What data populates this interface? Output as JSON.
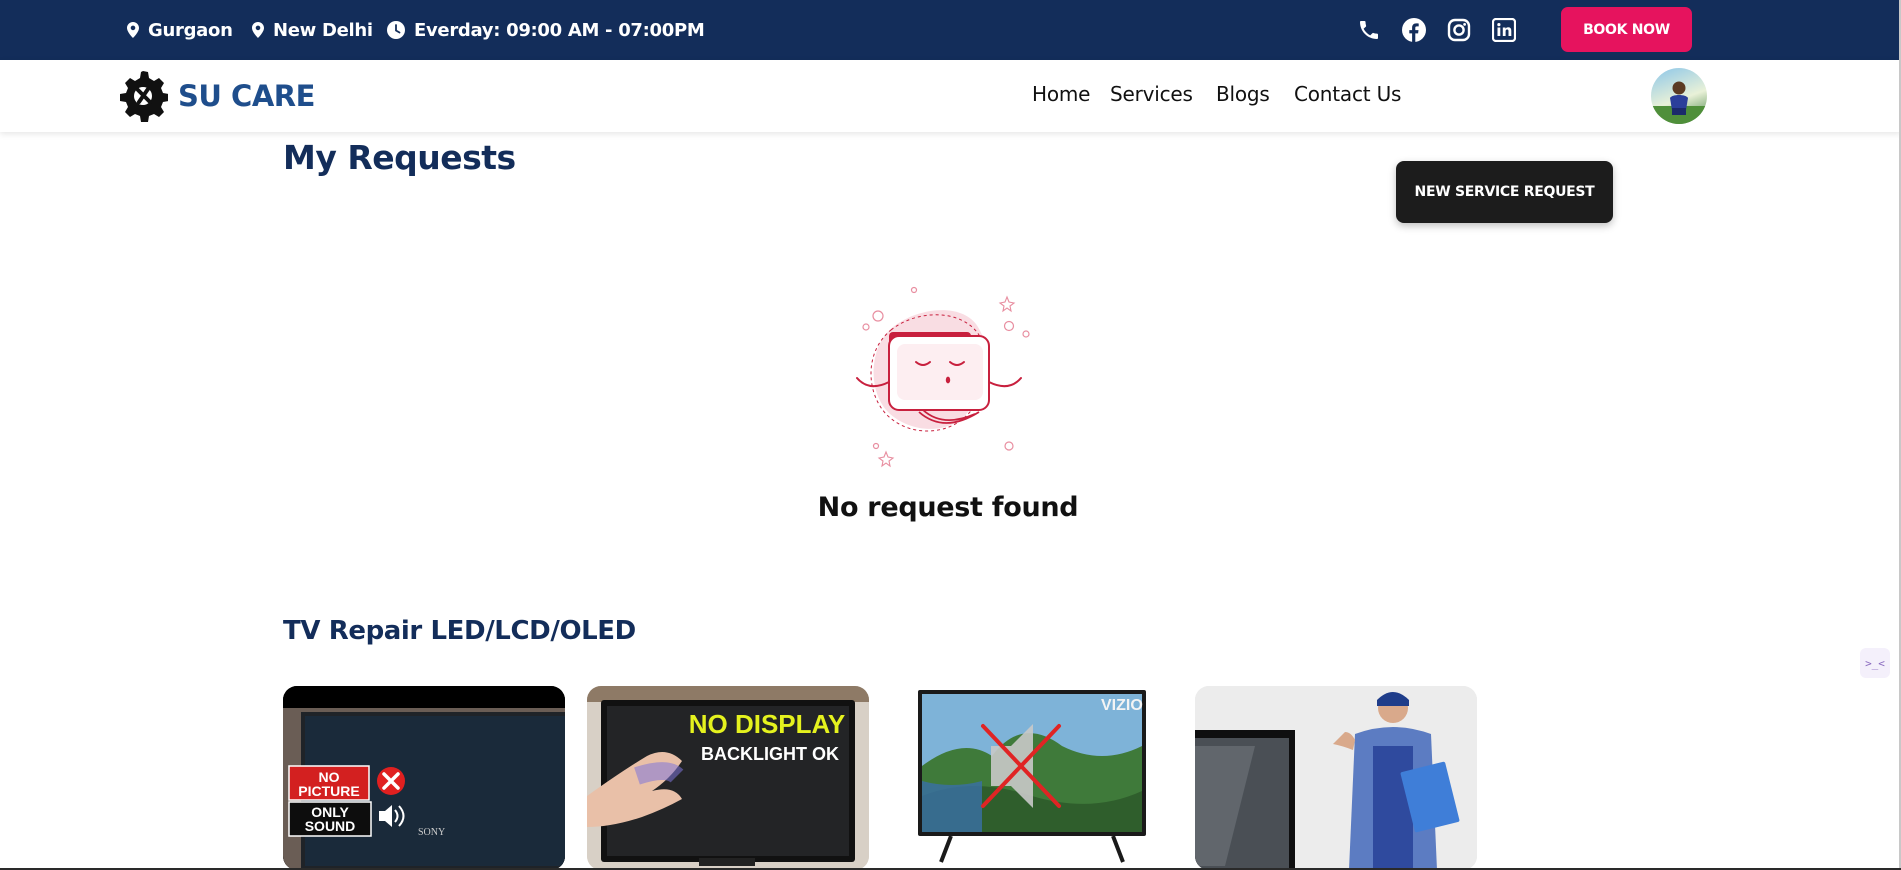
{
  "topbar": {
    "location_1": "Gurgaon",
    "location_2": "New Delhi",
    "hours": "Everday: 09:00 AM - 07:00PM",
    "book_label": "BOOK NOW"
  },
  "brand": {
    "name": "SU CARE"
  },
  "nav": {
    "home": "Home",
    "services": "Services",
    "blogs": "Blogs",
    "contact": "Contact Us"
  },
  "main": {
    "title": "My Requests",
    "new_request_label": "NEW SERVICE REQUEST",
    "empty_message": "No request found"
  },
  "section": {
    "title": "TV Repair LED/LCD/OLED",
    "cards": [
      {
        "line1": "NO",
        "line2": "PICTURE",
        "line3": "ONLY",
        "line4": "SOUND",
        "brand": "SONY"
      },
      {
        "line1": "NO DISPLAY",
        "line2": "BACKLIGHT OK"
      },
      {
        "brand": "VIZIO"
      },
      {}
    ]
  },
  "colors": {
    "topbar": "#132d5a",
    "accent": "#e6135e",
    "brand": "#1f4e8c",
    "dark_button": "#1c1c1c"
  },
  "icons": [
    "map-pin-icon",
    "clock-icon",
    "phone-icon",
    "facebook-icon",
    "instagram-icon",
    "linkedin-icon",
    "gear-wrench-logo-icon"
  ]
}
